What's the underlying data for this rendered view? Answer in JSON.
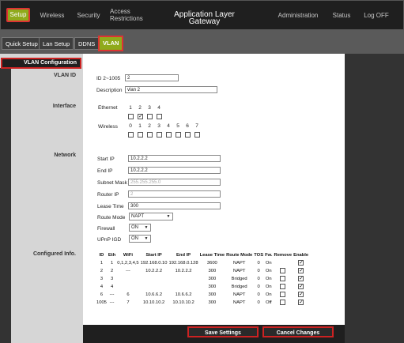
{
  "nav": {
    "items": [
      "Setup",
      "Wireless",
      "Security",
      "Access Restrictions",
      "Application Layer Gateway",
      "Administration",
      "Status",
      "Log OFF"
    ],
    "access_line1": "Access",
    "access_line2": "Restrictions"
  },
  "subnav": {
    "tabs": [
      "Quick Setup",
      "Lan Setup",
      "DDNS",
      "VLAN"
    ]
  },
  "sections": {
    "vlan_config": "VLAN Configuration",
    "vlan_id": "VLAN ID",
    "interface": "Interface",
    "network": "Network",
    "configured": "Configured Info."
  },
  "vlan": {
    "id_label": "ID 2~1005",
    "id_value": "2",
    "desc_label": "Description",
    "desc_value": "vlan 2"
  },
  "interface": {
    "ethernet_label": "Ethernet",
    "ethernet_ports": [
      "1",
      "2",
      "3",
      "4"
    ],
    "ethernet_checked": [
      false,
      true,
      false,
      false
    ],
    "wireless_label": "Wireless",
    "wireless_ports": [
      "0",
      "1",
      "2",
      "3",
      "4",
      "5",
      "6",
      "7"
    ],
    "wireless_checked": [
      false,
      false,
      false,
      false,
      false,
      false,
      false,
      false
    ]
  },
  "network": {
    "start_ip_label": "Start IP",
    "start_ip": "10.2.2.2",
    "end_ip_label": "End IP",
    "end_ip": "10.2.2.2",
    "subnet_label": "Subnet Mask",
    "subnet": "255.255.255.0",
    "router_ip_label": "Router IP",
    "router_ip": "2",
    "lease_label": "Lease Time",
    "lease": "300",
    "route_mode_label": "Route Mode",
    "route_mode": "NAPT",
    "firewall_label": "Firewall",
    "firewall": "ON",
    "upnp_label": "UPnP IGD",
    "upnp": "ON"
  },
  "table": {
    "headers": [
      "ID",
      "Eth",
      "WiFi",
      "Start IP",
      "End IP",
      "Lease Time",
      "Route Mode",
      "TOS",
      "Fw.",
      "Remove",
      "Enable"
    ],
    "rows": [
      {
        "id": "1",
        "eth": "1",
        "wifi": "0,1,2,3,4,5",
        "start": "192.168.0.10",
        "end": "192.168.0.128",
        "lease": "3600",
        "mode": "NAPT",
        "tos": "0",
        "fw": "On",
        "remove": null,
        "enable": true
      },
      {
        "id": "2",
        "eth": "2",
        "wifi": "---",
        "start": "10.2.2.2",
        "end": "10.2.2.2",
        "lease": "300",
        "mode": "NAPT",
        "tos": "0",
        "fw": "On",
        "remove": false,
        "enable": true
      },
      {
        "id": "3",
        "eth": "3",
        "wifi": "",
        "start": "",
        "end": "",
        "lease": "300",
        "mode": "Bridged",
        "tos": "0",
        "fw": "On",
        "remove": false,
        "enable": true
      },
      {
        "id": "4",
        "eth": "4",
        "wifi": "",
        "start": "",
        "end": "",
        "lease": "300",
        "mode": "Bridged",
        "tos": "0",
        "fw": "On",
        "remove": false,
        "enable": true
      },
      {
        "id": "6",
        "eth": "---",
        "wifi": "6",
        "start": "10.6.6.2",
        "end": "10.6.6.2",
        "lease": "300",
        "mode": "NAPT",
        "tos": "0",
        "fw": "On",
        "remove": false,
        "enable": true
      },
      {
        "id": "1005",
        "eth": "---",
        "wifi": "7",
        "start": "10.10.10.2",
        "end": "10.10.10.2",
        "lease": "300",
        "mode": "NAPT",
        "tos": "0",
        "fw": "Off",
        "remove": false,
        "enable": true
      }
    ]
  },
  "buttons": {
    "save": "Save Settings",
    "cancel": "Cancel Changes"
  },
  "colors": {
    "accent": "#8faa1b",
    "highlight": "#dd3333",
    "dark": "#1f1f1f"
  }
}
